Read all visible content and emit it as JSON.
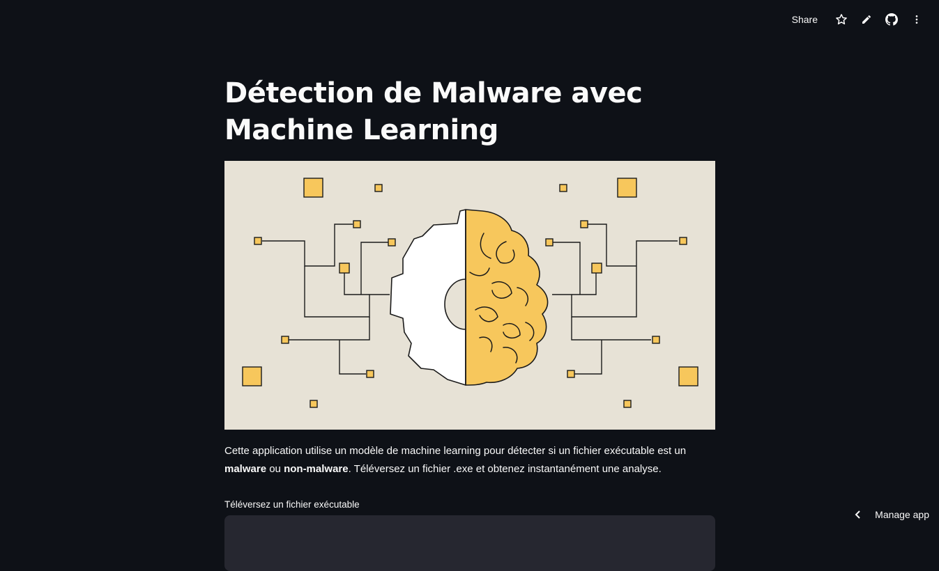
{
  "toolbar": {
    "share_label": "Share",
    "icons": [
      "star-icon",
      "pencil-icon",
      "github-icon",
      "more-vertical-icon"
    ]
  },
  "main": {
    "title": "Détection de Malware avec Machine Learning",
    "hero_image": {
      "alt": "brain-gear-circuit-illustration"
    },
    "description": {
      "part1": "Cette application utilise un modèle de machine learning pour détecter si un fichier exécutable est un ",
      "bold1": "malware",
      "part2": " ou ",
      "bold2": "non-malware",
      "part3": ". Téléversez un fichier .exe et obtenez instantanément une analyse."
    },
    "uploader_label": "Téléversez un fichier exécutable"
  },
  "footer": {
    "manage_label": "Manage app"
  },
  "colors": {
    "background": "#0e1117",
    "hero_bg": "#e7e2d6",
    "accent_yellow": "#f7c75c",
    "dropzone": "#262730"
  }
}
